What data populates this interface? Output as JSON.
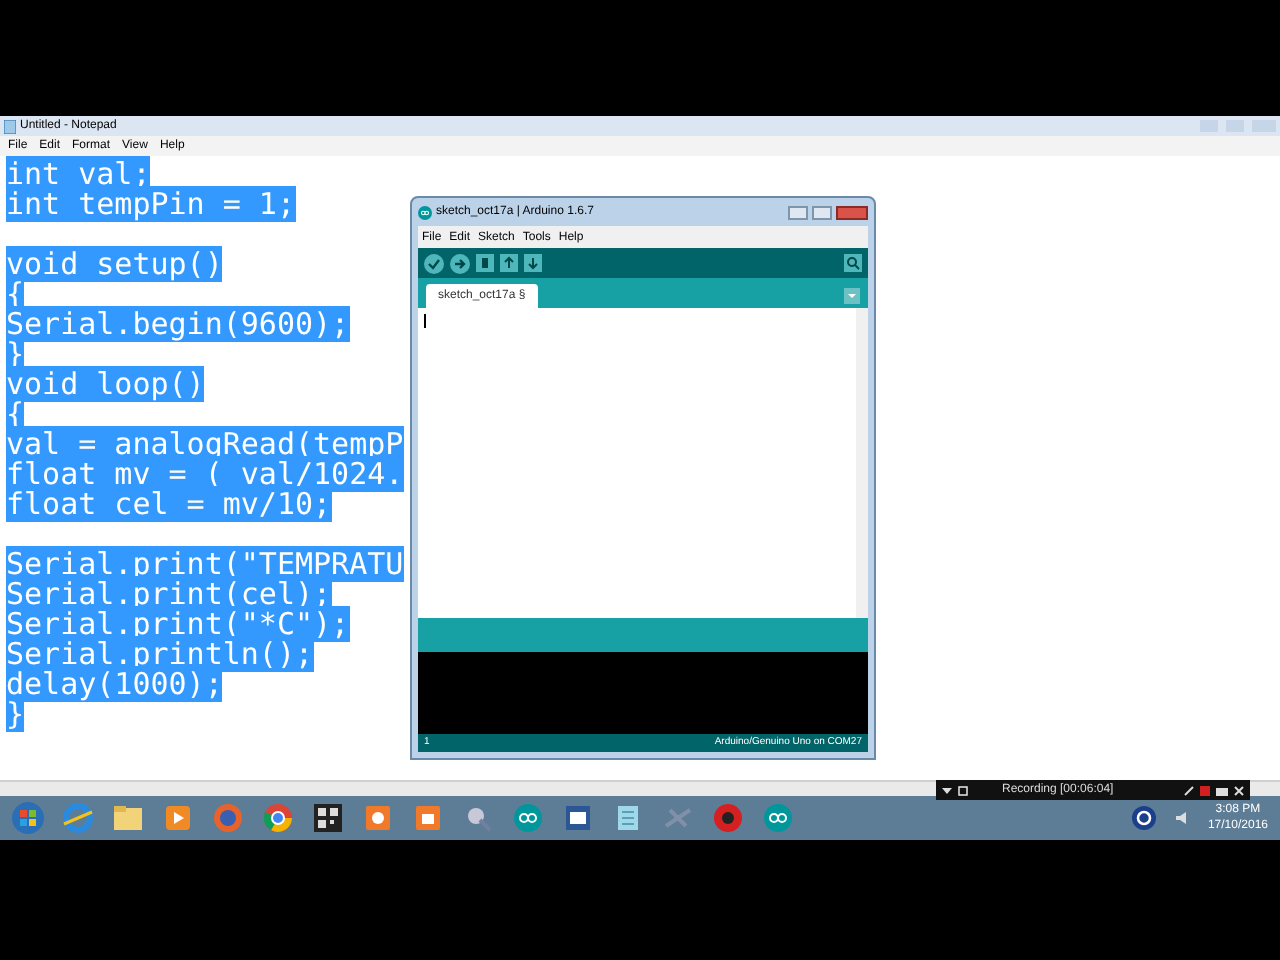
{
  "notepad": {
    "title": "Untitled - Notepad",
    "menu": [
      "File",
      "Edit",
      "Format",
      "View",
      "Help"
    ],
    "lines": [
      {
        "kind": "code",
        "text": "int val;",
        "selected": true
      },
      {
        "kind": "code",
        "text": "int tempPin = 1;",
        "selected": true
      },
      {
        "kind": "blank"
      },
      {
        "kind": "code",
        "text": "void setup()",
        "selected": true
      },
      {
        "kind": "code",
        "text": "{",
        "selected": true
      },
      {
        "kind": "code",
        "text": "Serial.begin(9600);",
        "selected": true
      },
      {
        "kind": "code",
        "text": "}",
        "selected": true
      },
      {
        "kind": "code",
        "text": "void loop()",
        "selected": true
      },
      {
        "kind": "code",
        "text": "{",
        "selected": true
      },
      {
        "kind": "code",
        "text": "val = analogRead(tempP",
        "selected": true
      },
      {
        "kind": "code",
        "text": "float mv = ( val/1024.",
        "selected": true
      },
      {
        "kind": "code",
        "text": "float cel = mv/10;",
        "selected": true
      },
      {
        "kind": "blank"
      },
      {
        "kind": "code",
        "text": "Serial.print(\"TEMPRATU",
        "selected": true
      },
      {
        "kind": "code",
        "text": "Serial.print(cel);",
        "selected": true
      },
      {
        "kind": "code",
        "text": "Serial.print(\"*C\");",
        "selected": true
      },
      {
        "kind": "code",
        "text": "Serial.println();",
        "selected": true
      },
      {
        "kind": "code",
        "text": "delay(1000);",
        "selected": true
      },
      {
        "kind": "code",
        "text": "}",
        "selected": true
      }
    ]
  },
  "arduino": {
    "title": "sketch_oct17a | Arduino 1.6.7",
    "menu": [
      "File",
      "Edit",
      "Sketch",
      "Tools",
      "Help"
    ],
    "tab": "sketch_oct17a §",
    "line_number": "1",
    "board": "Arduino/Genuino Uno on COM27"
  },
  "recorder": {
    "status": "Recording [00:06:04]"
  },
  "taskbar": {
    "time": "3:08 PM",
    "date": "17/10/2016"
  }
}
